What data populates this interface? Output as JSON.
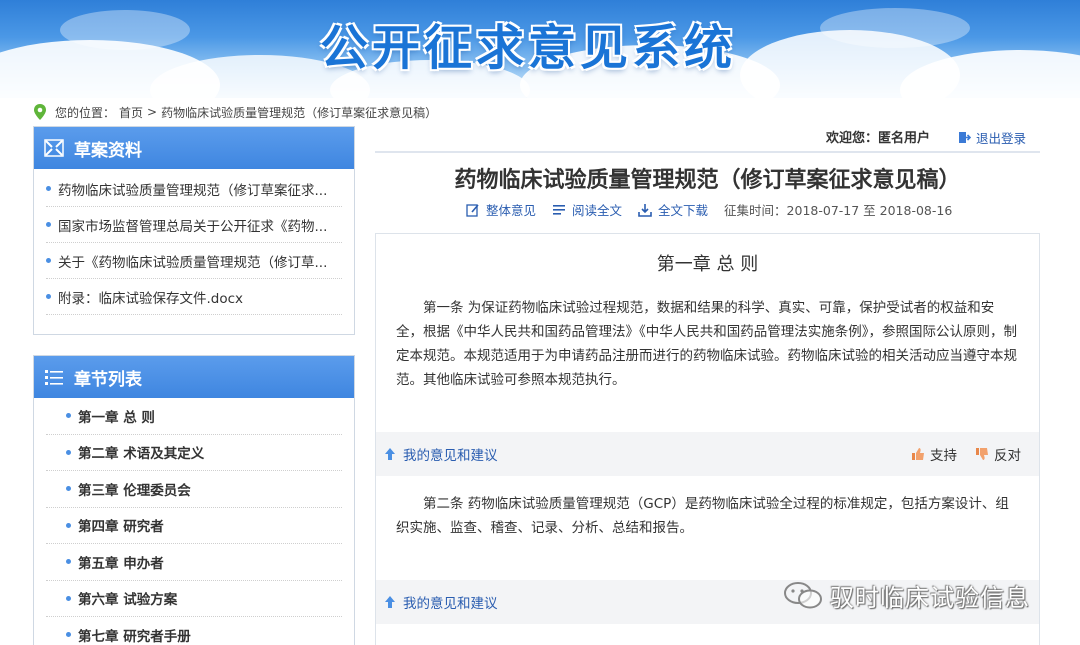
{
  "banner": {
    "title": "公开征求意见系统"
  },
  "breadcrumb": {
    "prefix": "您的位置：",
    "home": "首页",
    "separator": ">",
    "current": "药物临床试验质量管理规范（修订草案征求意见稿）"
  },
  "drafts_panel": {
    "title": "草案资料",
    "items": [
      "药物临床试验质量管理规范（修订草案征求...",
      "国家市场监督管理总局关于公开征求《药物...",
      "关于《药物临床试验质量管理规范（修订草...",
      "附录：临床试验保存文件.docx"
    ]
  },
  "chapters_panel": {
    "title": "章节列表",
    "items": [
      "第一章 总 则",
      "第二章 术语及其定义",
      "第三章 伦理委员会",
      "第四章 研究者",
      "第五章 申办者",
      "第六章 试验方案",
      "第七章 研究者手册"
    ]
  },
  "user": {
    "welcome": "欢迎您：",
    "name": "匿名用户",
    "logout": "退出登录"
  },
  "document": {
    "title": "药物临床试验质量管理规范（修订草案征求意见稿）",
    "actions": {
      "overall": "整体意见",
      "read": "阅读全文",
      "download": "全文下载"
    },
    "period": "征集时间：2018-07-17 至 2018-08-16",
    "chapter_heading": "第一章 总 则",
    "articles": [
      "第一条 为保证药物临床试验过程规范，数据和结果的科学、真实、可靠，保护受试者的权益和安全，根据《中华人民共和国药品管理法》《中华人民共和国药品管理法实施条例》，参照国际公认原则，制定本规范。本规范适用于为申请药品注册而进行的药物临床试验。药物临床试验的相关活动应当遵守本规范。其他临床试验可参照本规范执行。",
      "第二条 药物临床试验质量管理规范（GCP）是药物临床试验全过程的标准规定，包括方案设计、组织实施、监查、稽查、记录、分析、总结和报告。"
    ],
    "opinion_label": "我的意见和建议",
    "support": "支持",
    "oppose": "反对"
  },
  "watermark": "驭时临床试验信息",
  "colors": {
    "accent": "#4a8fe3",
    "link": "#2a5db0",
    "panel_header": "#4a8fe3"
  },
  "icons": [
    "location-pin-icon",
    "fold-icon",
    "list-icon",
    "logout-icon",
    "edit-icon",
    "read-icon",
    "download-icon",
    "up-arrow-icon",
    "thumbs-up-icon",
    "thumbs-down-icon",
    "wechat-icon"
  ]
}
